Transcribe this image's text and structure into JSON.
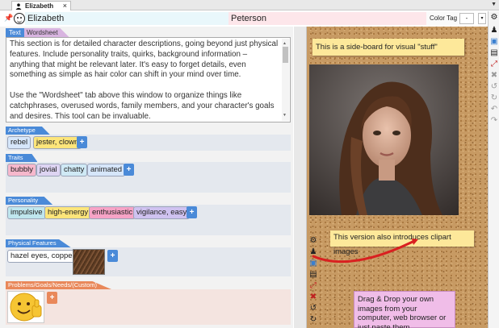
{
  "tab": {
    "title": "Elizabeth",
    "close": "×",
    "menu": "▼"
  },
  "namebar": {
    "pin": "📌",
    "first_name": "Elizabeth",
    "last_name": "Peterson",
    "color_tag_label": "Color Tag",
    "color_tag_value": "-",
    "dropdown": "▾"
  },
  "text_tabs": {
    "text": "Text",
    "wordsheet": "Wordsheet"
  },
  "description": {
    "p1": "This section is for detailed character descriptions, going beyond just physical features. Include personality traits, quirks, background information – anything that might be relevant later. It's easy to forget details, even something as simple as hair color can shift in your mind over time.",
    "p2": "Use the \"Wordsheet\" tab above this window to organize things like catchphrases, overused words, family members, and your character's goals and desires. This tool can be invaluable."
  },
  "sections": {
    "archetype": {
      "title": "Archetype",
      "tags": [
        "rebel",
        "jester, clown"
      ]
    },
    "traits": {
      "title": "Traits",
      "tags": [
        "bubbly",
        "jovial",
        "chatty",
        "animated"
      ]
    },
    "personality": {
      "title": "Personality",
      "tags": [
        "impulsive",
        "high-energy",
        "enthusiastic",
        "vigilance, easy"
      ]
    },
    "physical": {
      "title": "Physical Features",
      "tags": [
        "hazel eyes, copper"
      ]
    },
    "problems": {
      "title": "Problems/Goals/Needs/(Custom)"
    }
  },
  "plus_label": "+",
  "corkboard": {
    "note1": "This is a side-board for visual \"stuff\"",
    "note2": "This version also introduces clipart images",
    "note3": "Drag & Drop your own images from your computer, web browser or just paste them"
  },
  "colors": {
    "accent_blue": "#4a8ad8",
    "wordsheet_purple": "#d8b4e0",
    "problems_orange": "#e9885a",
    "note_yellow": "#fde89a",
    "note_pink": "#f0bde8",
    "arrow_red": "#d92020",
    "tag_blue": "#d6e6fa",
    "tag_yellow": "#fde57a",
    "tag_pink": "#f6a3c6",
    "tag_purple": "#cfc2f0",
    "tag_teal": "#bfe6ee"
  },
  "icons": {
    "right_toolbar": [
      "gear-icon",
      "person-icon",
      "image-icon",
      "document-icon",
      "link-icon",
      "delete-icon",
      "rotate-left-icon",
      "rotate-right-icon",
      "undo-icon",
      "redo-icon"
    ],
    "mid_toolbar": [
      "gear-icon",
      "person-icon",
      "image-icon",
      "document-icon",
      "link-icon",
      "delete-icon",
      "rotate-left-icon",
      "rotate-right-icon"
    ]
  }
}
